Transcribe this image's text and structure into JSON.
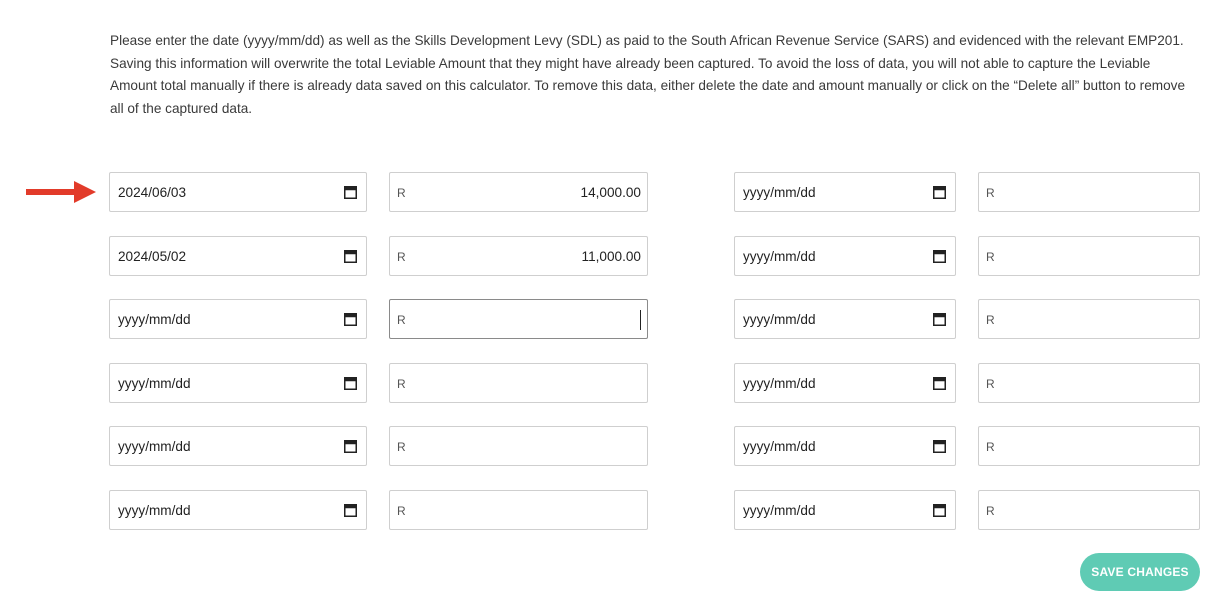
{
  "instructions": {
    "paragraph_1": "Please enter the date (yyyy/mm/dd) as well as the Skills Development Levy (SDL) as paid to the South African Revenue Service (SARS) and evidenced with the relevant EMP201.",
    "paragraph_2": "Saving this information will overwrite the total Leviable Amount that they might have already been captured. To avoid the loss of data, you will not able to capture the Leviable Amount total manually if there is already data saved on this calculator. To remove this data, either delete the date and amount manually or click on the “Delete all” button to remove all of the captured data."
  },
  "currency_prefix": "R",
  "date_placeholder": "yyyy/mm/dd",
  "left_column": [
    {
      "date": "2024/06/03",
      "amount": "14,000.00"
    },
    {
      "date": "2024/05/02",
      "amount": "11,000.00"
    },
    {
      "date": "yyyy/mm/dd",
      "amount": ""
    },
    {
      "date": "yyyy/mm/dd",
      "amount": ""
    },
    {
      "date": "yyyy/mm/dd",
      "amount": ""
    },
    {
      "date": "yyyy/mm/dd",
      "amount": ""
    }
  ],
  "right_column": [
    {
      "date": "yyyy/mm/dd",
      "amount": ""
    },
    {
      "date": "yyyy/mm/dd",
      "amount": ""
    },
    {
      "date": "yyyy/mm/dd",
      "amount": ""
    },
    {
      "date": "yyyy/mm/dd",
      "amount": ""
    },
    {
      "date": "yyyy/mm/dd",
      "amount": ""
    },
    {
      "date": "yyyy/mm/dd",
      "amount": ""
    }
  ],
  "save_button": {
    "label": "SAVE CHANGES"
  },
  "colors": {
    "accent": "#5fcbb4",
    "arrow": "#e23b2a",
    "border": "#cfcfcf",
    "text": "#333333"
  },
  "icons": {
    "date_picker": "calendar-icon",
    "pointer": "arrow-right-icon"
  }
}
